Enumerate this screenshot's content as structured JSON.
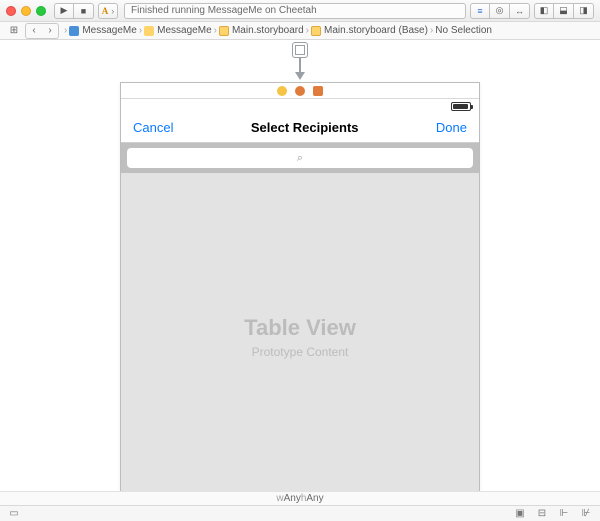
{
  "toolbar": {
    "status_text": "Finished running MessageMe on Cheetah"
  },
  "breadcrumbs": [
    {
      "icon": "blue",
      "label": "MessageMe"
    },
    {
      "icon": "folder",
      "label": "MessageMe"
    },
    {
      "icon": "sb",
      "label": "Main.storyboard"
    },
    {
      "icon": "sb",
      "label": "Main.storyboard (Base)"
    },
    {
      "icon": "",
      "label": "No Selection"
    }
  ],
  "scene": {
    "nav_left": "Cancel",
    "nav_title": "Select Recipients",
    "nav_right": "Done",
    "search_placeholder": " ",
    "table_placeholder_title": "Table View",
    "table_placeholder_sub": "Prototype Content"
  },
  "sizeclass": {
    "w_prefix": "w",
    "w_value": "Any",
    "h_prefix": " h",
    "h_value": "Any"
  }
}
